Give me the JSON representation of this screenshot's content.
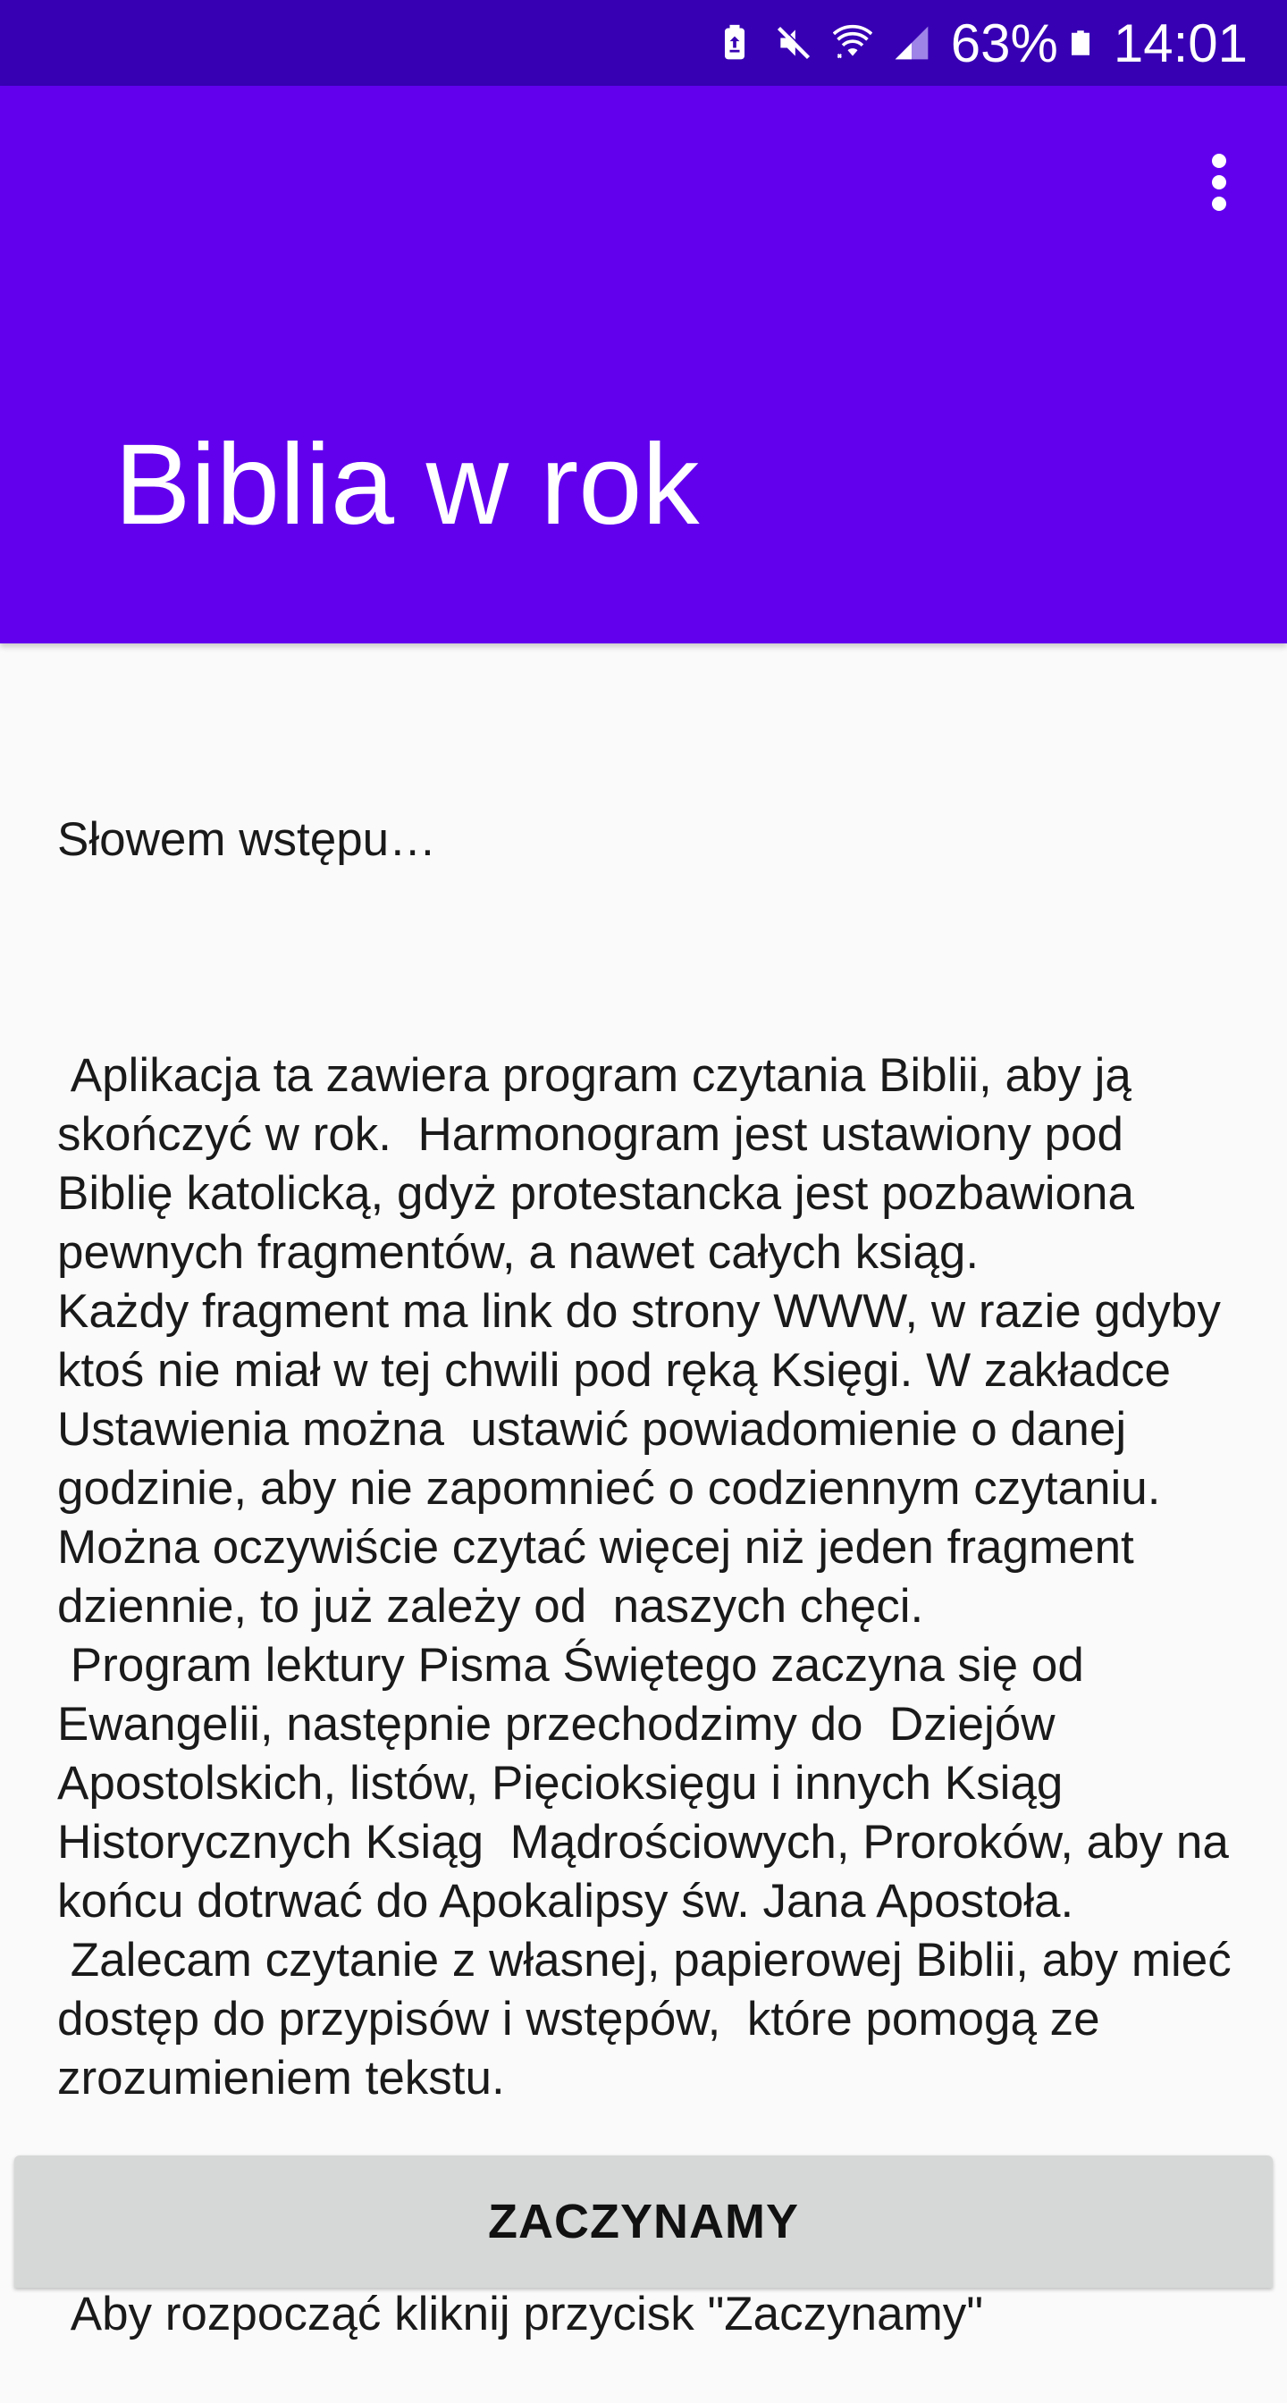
{
  "status_bar": {
    "battery_percent": "63%",
    "time": "14:01",
    "icons": [
      "battery-saver-icon",
      "mute-icon",
      "wifi-icon",
      "signal-icon",
      "battery-icon"
    ]
  },
  "app_bar": {
    "title": "Biblia w rok",
    "overflow_icon": "more-vert-icon",
    "color": "#6200ee",
    "status_color": "#3700b3"
  },
  "intro": {
    "heading": "Słowem wstępu…",
    "body": " Aplikacja ta zawiera program czytania Biblii, aby ją skończyć w rok.  Harmonogram jest ustawiony pod Biblię katolicką, gdyż protestancka jest pozbawiona pewnych fragmentów, a nawet całych ksiąg.\nKażdy fragment ma link do strony WWW, w razie gdyby  ktoś nie miał w tej chwili pod ręką Księgi. W zakładce Ustawienia można  ustawić powiadomienie o danej godzinie, aby nie zapomnieć o codziennym czytaniu.  Można oczywiście czytać więcej niż jeden fragment dziennie, to już zależy od  naszych chęci.\n Program lektury Pisma Świętego zaczyna się od Ewangelii, następnie przechodzimy do  Dziejów Apostolskich, listów, Pięcioksięgu i innych Ksiąg Historycznych Ksiąg  Mądrościowych, Proroków, aby na końcu dotrwać do Apokalipsy św. Jana Apostoła.\n Zalecam czytanie z własnej, papierowej Biblii, aby mieć dostęp do przypisów i wstępów,  które pomogą ze zrozumieniem tekstu.",
    "cta": " Aby rozpocząć kliknij przycisk \"Zaczynamy\""
  },
  "start_button": {
    "label": "ZACZYNAMY"
  }
}
